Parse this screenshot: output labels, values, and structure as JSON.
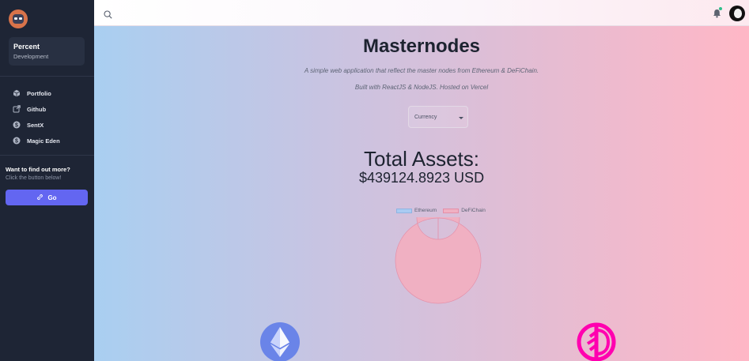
{
  "sidebar": {
    "profile": {
      "name": "Percent",
      "role": "Development"
    },
    "items": [
      {
        "label": "Portfolio",
        "icon": "cube-icon"
      },
      {
        "label": "Github",
        "icon": "external-link-icon"
      },
      {
        "label": "SentX",
        "icon": "dollar-circle-icon"
      },
      {
        "label": "Magic Eden",
        "icon": "dollar-circle-icon"
      }
    ],
    "promo": {
      "title": "Want to find out more?",
      "subtitle": "Click the button below!",
      "button_label": "Go"
    }
  },
  "topbar": {
    "search_icon": "search-icon",
    "bell_icon": "bell-icon",
    "notification_indicator": "green"
  },
  "main": {
    "title": "Masternodes",
    "subtitle1": "A simple web application that reflect the master nodes from Ethereum & DeFiChain.",
    "subtitle2": "Built with ReactJS & NodeJS. Hosted on Vercel",
    "currency_select": {
      "label": "Currency"
    },
    "total_label": "Total Assets:",
    "total_value": "$439124.8923 USD"
  },
  "chart_data": {
    "type": "pie",
    "variant": "doughnut",
    "categories": [
      "Ethereum",
      "DeFiChain"
    ],
    "values": [
      0.0,
      1.0
    ],
    "colors": [
      "#a9cbf2",
      "#f0b0c2"
    ],
    "legend": "top"
  },
  "colors": {
    "sidebar": "#1e2535",
    "accent": "#6366f1",
    "ethereum": "#6a84e8",
    "defichain": "#ff00af"
  },
  "logos": [
    "ethereum-logo",
    "defichain-logo"
  ]
}
